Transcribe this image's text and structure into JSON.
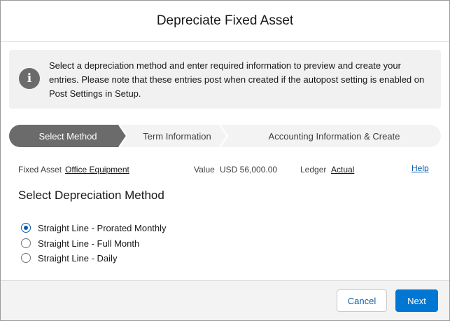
{
  "modal": {
    "title": "Depreciate Fixed Asset",
    "info": {
      "icon": "info-icon",
      "text": "Select a depreciation method and enter required information to preview and create your entries. Please note that these entries post when created if the autopost setting is enabled on Post Settings in Setup."
    },
    "path": {
      "steps": [
        {
          "label": "Select Method",
          "state": "active"
        },
        {
          "label": "Term Information",
          "state": "incomplete"
        },
        {
          "label": "Accounting Information & Create",
          "state": "incomplete"
        }
      ],
      "active_color": "#6b6b6b",
      "inactive_color": "#f3f3f3"
    },
    "fields": {
      "fixed_asset_label": "Fixed Asset",
      "fixed_asset_value": "Office Equipment",
      "value_label": "Value",
      "value_value": "USD 56,000.00",
      "ledger_label": "Ledger",
      "ledger_value": "Actual",
      "help_label": "Help"
    },
    "section_title": "Select Depreciation Method",
    "methods": [
      {
        "label": "Straight Line - Prorated Monthly",
        "selected": true
      },
      {
        "label": "Straight Line - Full Month",
        "selected": false
      },
      {
        "label": "Straight Line - Daily",
        "selected": false
      }
    ],
    "footer": {
      "cancel_label": "Cancel",
      "next_label": "Next"
    },
    "colors": {
      "brand": "#0176d3",
      "link": "#0b5cab"
    }
  }
}
